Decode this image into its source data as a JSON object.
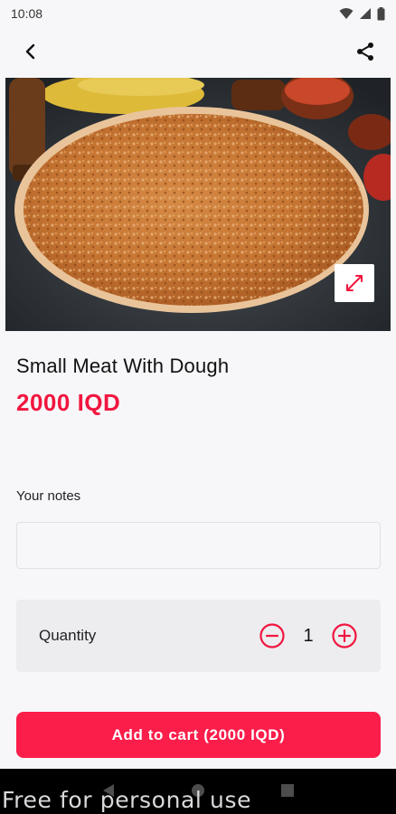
{
  "status_bar": {
    "time": "10:08"
  },
  "product": {
    "name": "Small Meat With Dough",
    "price": "2000 IQD"
  },
  "notes": {
    "label": "Your notes",
    "value": "",
    "placeholder": ""
  },
  "quantity": {
    "label": "Quantity",
    "value": "1"
  },
  "cart_button": {
    "label": "Add to cart (2000 IQD)"
  },
  "watermark": "Free for personal use",
  "colors": {
    "accent": "#f1163f",
    "button": "#fb1d4a",
    "background": "#f7f7f9"
  },
  "icons": [
    "back-arrow-icon",
    "share-icon",
    "expand-icon",
    "minus-circle-icon",
    "plus-circle-icon",
    "wifi-icon",
    "signal-icon",
    "battery-icon"
  ]
}
